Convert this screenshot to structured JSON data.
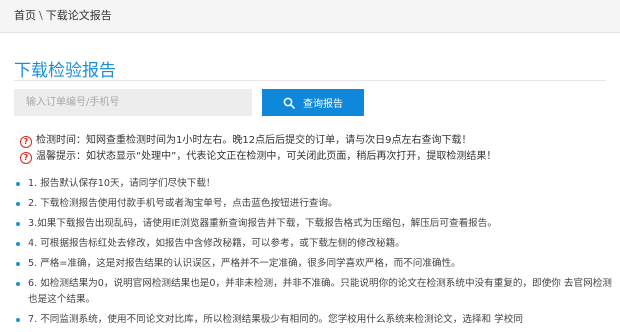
{
  "breadcrumb": {
    "home": "首页",
    "separator": "\\",
    "current": "下载论文报告"
  },
  "page": {
    "title": "下载检验报告"
  },
  "search": {
    "placeholder": "输入订单编号/手机号",
    "button_label": "查询报告"
  },
  "notices": [
    {
      "text": "检测时间：知网查重检测时间为1小时左右。晚12点后后提交的订单，请与次日9点左右查询下载！"
    },
    {
      "text": "温馨提示：如状态显示“处理中”，代表论文正在检测中，可关闭此页面，稍后再次打开，提取检测结果！"
    }
  ],
  "rules": [
    "1. 报告默认保存10天，请同学们尽快下载！",
    "2. 下载检测报告使用付款手机号或者淘宝单号，点击蓝色按钮进行查询。",
    "3.如果下载报告出现乱码，请使用IE浏览器重新查询报告并下载，下载报告格式为压缩包，解压后可查看报告。",
    "4. 可根据报告标红处去修改，如报告中含修改秘籍，可以参考，或下载左侧的修改秘籍。",
    "5. 严格=准确，这是对报告结果的认识误区，严格并不一定准确，很多同学喜欢严格，而不问准确性。",
    "6. 如检测结果为0，说明官网检测结果也是0，并非未检测，并非不准确。只能说明你的论文在检测系统中没有重复的，即使你 去官网检测也是这个结果。",
    "7. 不同监测系统，使用不同论文对比库，所以检测结果极少有相同的。您学校用什么系统来检测论文，选择和 学校同"
  ],
  "colors": {
    "accent": "#1a8fd9",
    "button": "#0f88dc",
    "warning_icon": "#d9261c"
  },
  "icons": {
    "search": "search-icon",
    "notice": "question-circle-icon",
    "bullet": "bullet-dot-icon"
  }
}
